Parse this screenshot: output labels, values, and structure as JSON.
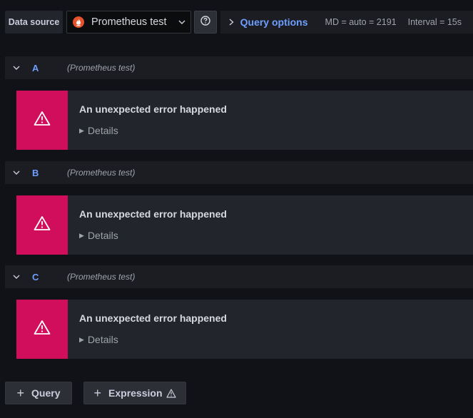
{
  "toolbar": {
    "datasource_label": "Data source",
    "datasource_name": "Prometheus test",
    "query_options_label": "Query options",
    "md_text": "MD = auto = 2191",
    "interval_text": "Interval = 15s"
  },
  "queries": [
    {
      "letter": "A",
      "datasource": "(Prometheus test)",
      "error_title": "An unexpected error happened",
      "details_label": "Details"
    },
    {
      "letter": "B",
      "datasource": "(Prometheus test)",
      "error_title": "An unexpected error happened",
      "details_label": "Details"
    },
    {
      "letter": "C",
      "datasource": "(Prometheus test)",
      "error_title": "An unexpected error happened",
      "details_label": "Details"
    }
  ],
  "actions": {
    "query_label": "Query",
    "expression_label": "Expression"
  },
  "colors": {
    "accent": "#6e9fff",
    "error": "#d10e5c",
    "prometheus": "#e6522c"
  }
}
